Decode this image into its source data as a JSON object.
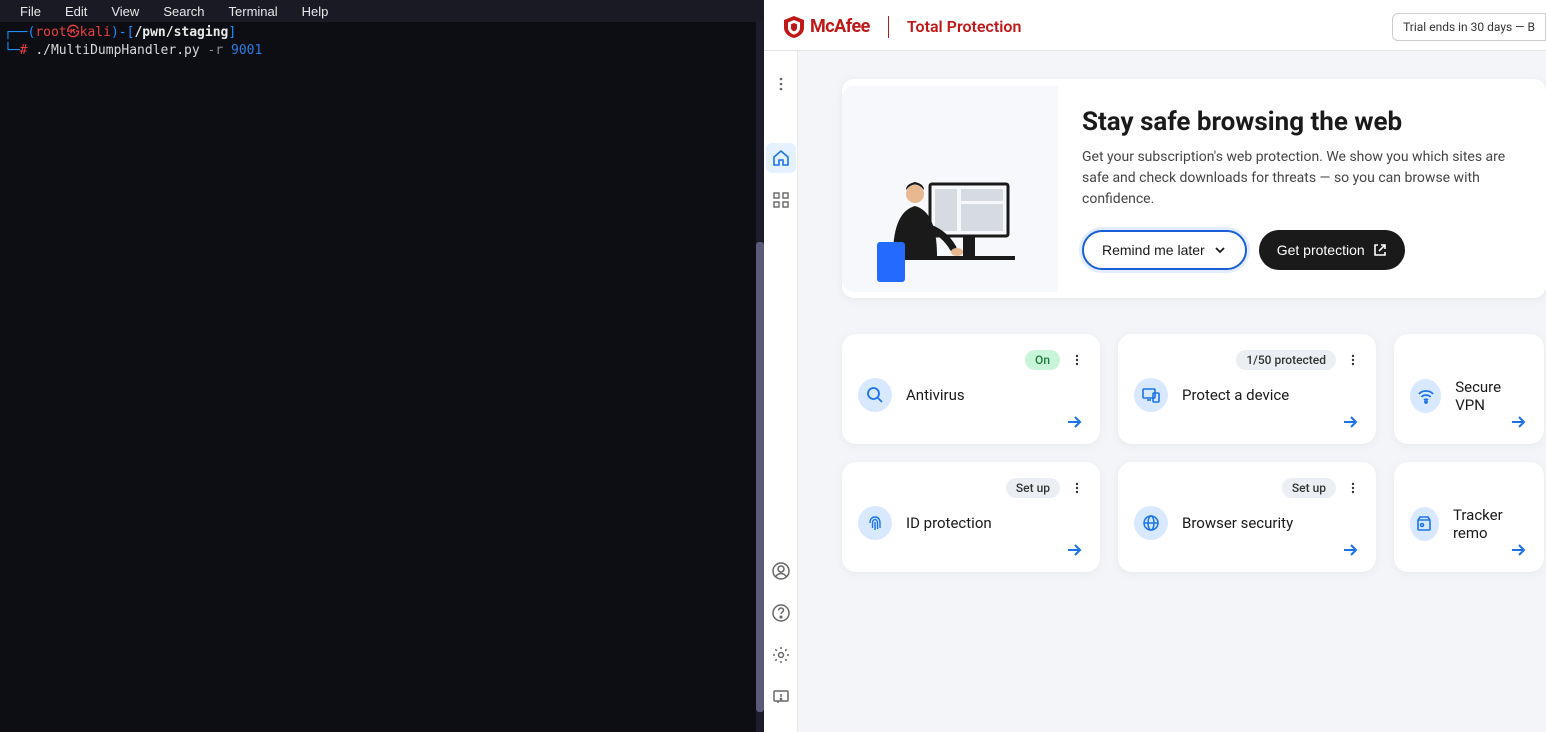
{
  "terminal": {
    "menu": [
      "File",
      "Edit",
      "View",
      "Search",
      "Terminal",
      "Help"
    ],
    "prompt": {
      "user": "root",
      "host": "kali",
      "path": "/pwn/staging"
    },
    "command": "./MultiDumpHandler.py",
    "flag": "-r",
    "arg": "9001"
  },
  "mcafee": {
    "brand": "McAfee",
    "product": "Total Protection",
    "trial": "Trial ends in 30 days — B",
    "hero": {
      "title": "Stay safe browsing the web",
      "desc": "Get your subscription's web protection. We show you which sites are safe and check downloads for threats — so you can browse with confidence.",
      "remind": "Remind me later",
      "get": "Get protection"
    },
    "tiles": [
      {
        "badge": "On",
        "badgeClass": "on",
        "label": "Antivirus",
        "icon": "search"
      },
      {
        "badge": "1/50 protected",
        "badgeClass": "",
        "label": "Protect a device",
        "icon": "device"
      },
      {
        "badge": "",
        "badgeClass": "",
        "label": "Secure VPN",
        "icon": "wifi"
      },
      {
        "badge": "Set up",
        "badgeClass": "",
        "label": "ID protection",
        "icon": "finger"
      },
      {
        "badge": "Set up",
        "badgeClass": "",
        "label": "Browser security",
        "icon": "globe"
      },
      {
        "badge": "",
        "badgeClass": "",
        "label": "Tracker remo",
        "icon": "tracker"
      }
    ]
  }
}
